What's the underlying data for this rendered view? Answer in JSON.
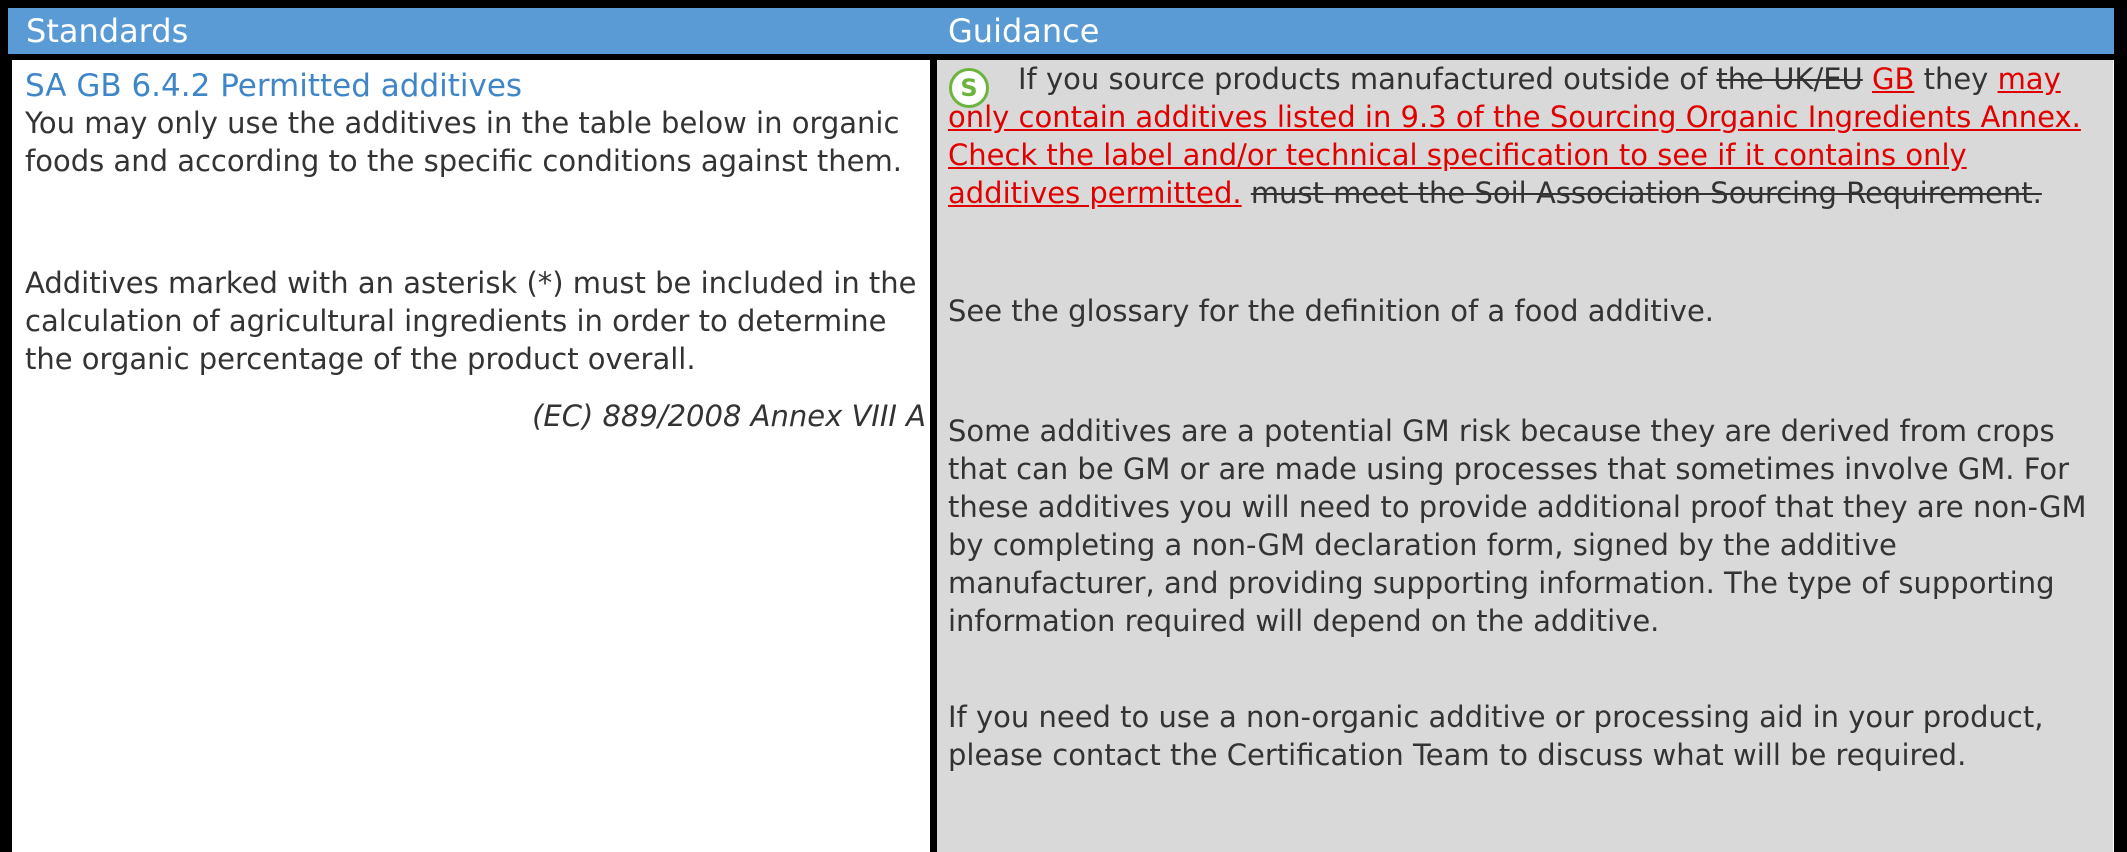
{
  "header": {
    "standards": "Standards",
    "guidance": "Guidance"
  },
  "standards": {
    "title": "SA GB 6.4.2 Permitted additives",
    "para1": "You may only use the additives in the table below in organic foods and according to the specific conditions against them.",
    "para2": "Additives marked with an asterisk (*) must be included in the calculation of agricultural ingredients in order to determine the organic percentage of the product overall.",
    "reference": "(EC) 889/2008 Annex VIII A"
  },
  "guidance": {
    "badge_icon": "soil-association-s-icon",
    "badge_letter": "S",
    "p1_text_a": "If you source products manufactured outside of ",
    "p1_deleted_a": "the UK/EU",
    "p1_space": " ",
    "p1_inserted_a": "GB",
    "p1_text_b": " they ",
    "p1_inserted_b": "may only contain additives listed in 9.3 of the Sourcing Organic Ingredients Annex. Check the label and/or technical specification to see if it contains only additives permitted.",
    "p1_deleted_b": "must meet the Soil Association Sourcing Requirement.",
    "p2": "See the glossary for the definition of a food additive.",
    "p3": "Some additives are a potential GM risk because they are derived from crops that can be GM or are made using processes that sometimes involve GM. For these additives you will need to provide additional proof that they are non-GM by completing a non-GM declaration form, signed by the additive manufacturer, and providing supporting information. The type of supporting information required will depend on the additive.",
    "p4": "If you need to use a non-organic additive or processing aid in your product, please contact the Certification Team to discuss what will be required."
  },
  "colors": {
    "header_bg": "#5b9bd5",
    "guidance_bg": "#d9d9d9",
    "title_blue": "#3f86c9",
    "insert_red": "#e00000",
    "badge_green": "#6db33f"
  }
}
